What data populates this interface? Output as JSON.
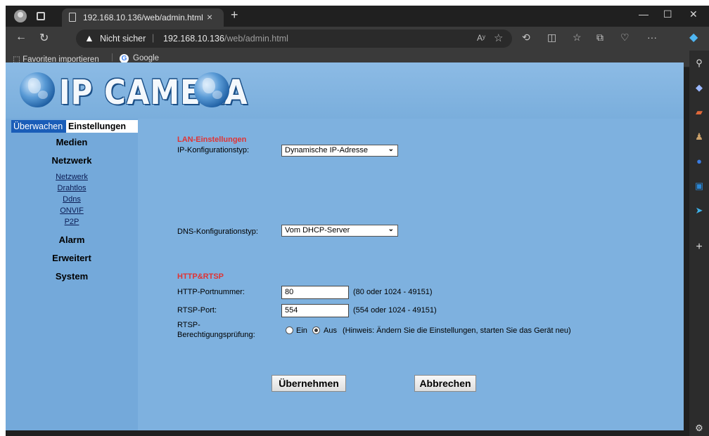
{
  "browser": {
    "tab_title": "192.168.10.136/web/admin.html",
    "tab_close": "×",
    "new_tab": "+",
    "address": {
      "security_label": "Nicht sicher",
      "url_host": "192.168.10.136",
      "url_path": "/web/admin.html",
      "read_aloud": "Aʸ"
    },
    "favorites": {
      "import_label": "Favoriten importieren",
      "google_label": "Google"
    }
  },
  "page": {
    "logo_text": "IP CAMERA",
    "nav": {
      "tab_watch": "Überwachen",
      "tab_settings": "Einstellungen",
      "medien": "Medien",
      "netzwerk": "Netzwerk",
      "sub_netzwerk": "Netzwerk",
      "sub_drahtlos": "Drahtlos",
      "sub_ddns": "Ddns",
      "sub_onvif": "ONVIF",
      "sub_p2p": "P2P",
      "alarm": "Alarm",
      "erweitert": "Erweitert",
      "system": "System"
    },
    "lan": {
      "title": "LAN-Einstellungen",
      "ip_config_label": "IP-Konfigurationstyp:",
      "ip_config_value": "Dynamische IP-Adresse",
      "dns_config_label": "DNS-Konfigurationstyp:",
      "dns_config_value": "Vom DHCP-Server"
    },
    "http_rtsp": {
      "title": "HTTP&RTSP",
      "http_port_label": "HTTP-Portnummer:",
      "http_port_value": "80",
      "http_port_hint": "(80 oder 1024 - 49151)",
      "rtsp_port_label": "RTSP-Port:",
      "rtsp_port_value": "554",
      "rtsp_port_hint": "(554 oder 1024 - 49151)",
      "rtsp_auth_label_1": "RTSP-",
      "rtsp_auth_label_2": "Berechtigungsprüfung:",
      "option_on": "Ein",
      "option_off": "Aus",
      "selected": "Aus",
      "auth_hint": "(Hinweis: Ändern Sie die Einstellungen, starten Sie das Gerät neu)"
    },
    "buttons": {
      "apply": "Übernehmen",
      "cancel": "Abbrechen"
    }
  },
  "colors": {
    "page_background": "#7eb1df",
    "section_title": "#e03333",
    "active_tab": "#1a5db8"
  }
}
